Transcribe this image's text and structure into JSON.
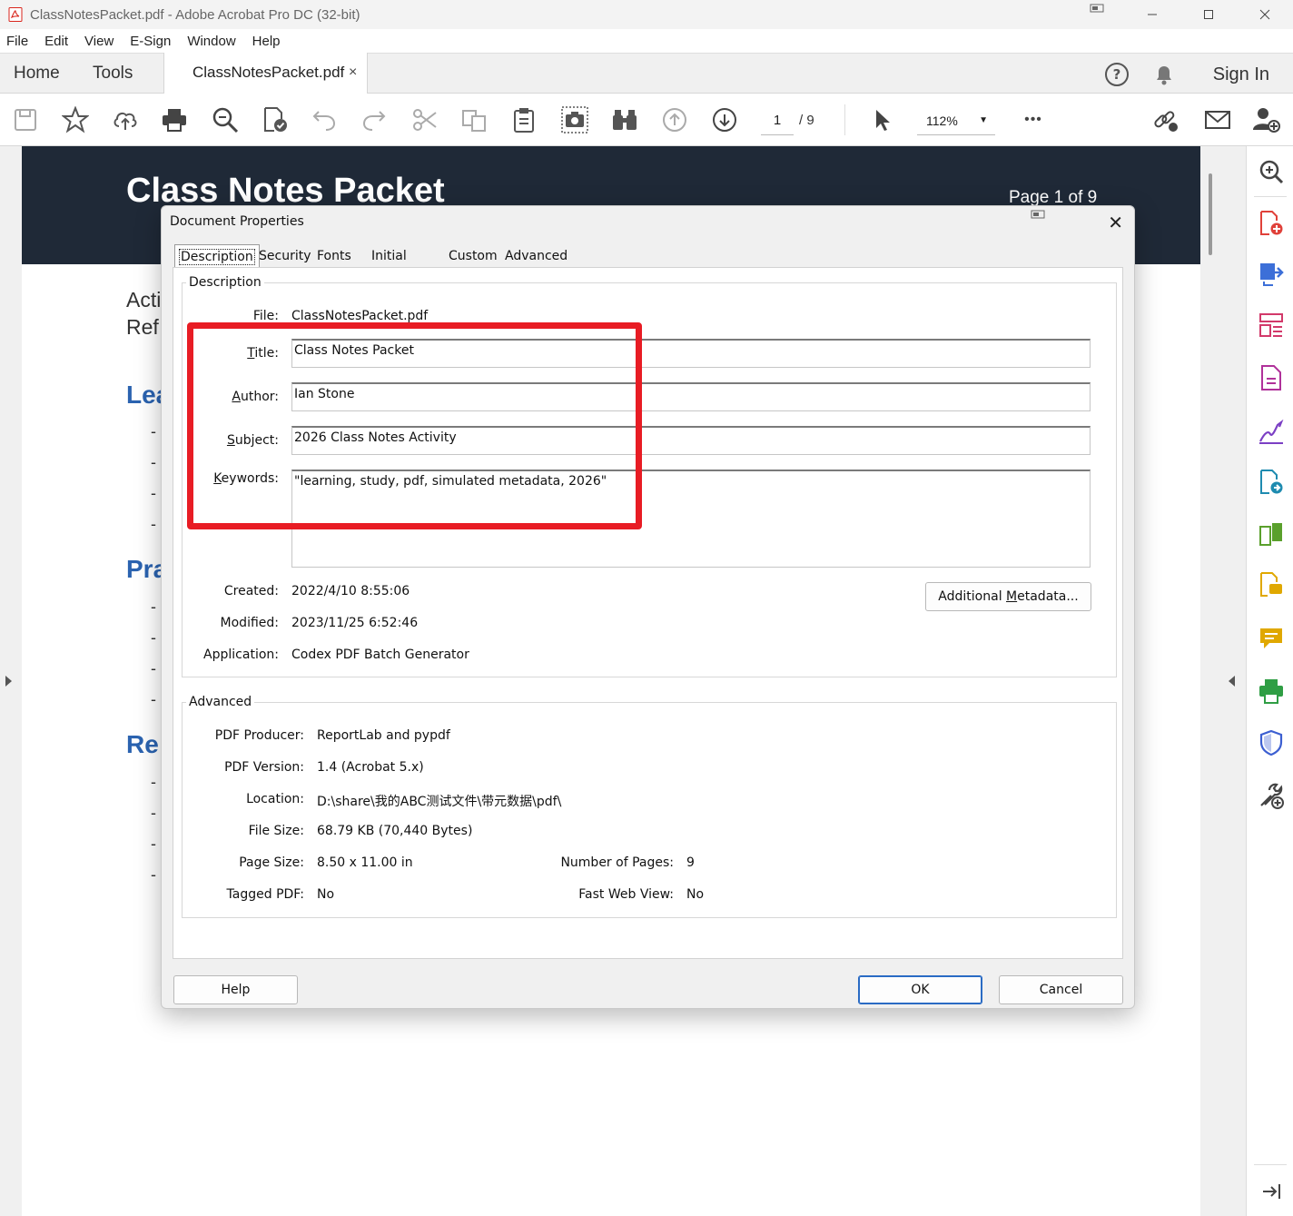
{
  "window": {
    "title": "ClassNotesPacket.pdf - Adobe Acrobat Pro DC (32-bit)"
  },
  "menu": [
    "File",
    "Edit",
    "View",
    "E-Sign",
    "Window",
    "Help"
  ],
  "tabs": {
    "home": "Home",
    "tools": "Tools",
    "document": "ClassNotesPacket.pdf",
    "close_glyph": "×",
    "sign_in": "Sign In"
  },
  "toolbar": {
    "page_current": "1",
    "page_total": "/ 9",
    "zoom": "112%",
    "more": "•••"
  },
  "page_content": {
    "title": "Class Notes Packet",
    "page_label": "Page 1 of 9",
    "partial_line1": "Acti",
    "partial_line2": "Ref",
    "heading1": "Lea",
    "heading2": "Pra",
    "heading3": "Re",
    "bullet": "-"
  },
  "dialog": {
    "title": "Document Properties",
    "close": "✕",
    "tabs": [
      "Description",
      "Security",
      "Fonts",
      "Initial View",
      "Custom",
      "Advanced"
    ],
    "active_tab": "Description",
    "description": {
      "group_title": "Description",
      "file_label": "File:",
      "file_value": "ClassNotesPacket.pdf",
      "title_label": "Title:",
      "title_value": "Class Notes Packet",
      "author_label": "Author:",
      "author_value": "Ian Stone",
      "subject_label": "Subject:",
      "subject_value": "2026 Class Notes Activity",
      "keywords_label": "Keywords:",
      "keywords_value": "\"learning, study, pdf, simulated metadata, 2026\"",
      "created_label": "Created:",
      "created_value": "2022/4/10 8:55:06",
      "modified_label": "Modified:",
      "modified_value": "2023/11/25 6:52:46",
      "application_label": "Application:",
      "application_value": "Codex PDF Batch Generator",
      "additional_metadata_button": "Additional Metadata..."
    },
    "advanced": {
      "group_title": "Advanced",
      "producer_label": "PDF Producer:",
      "producer_value": "ReportLab and pypdf",
      "version_label": "PDF Version:",
      "version_value": "1.4 (Acrobat 5.x)",
      "location_label": "Location:",
      "location_value": "D:\\share\\我的ABC测试文件\\带元数据\\pdf\\",
      "filesize_label": "File Size:",
      "filesize_value": "68.79 KB (70,440 Bytes)",
      "pagesize_label": "Page Size:",
      "pagesize_value": "8.50 x 11.00 in",
      "numpages_label": "Number of Pages:",
      "numpages_value": "9",
      "tagged_label": "Tagged PDF:",
      "tagged_value": "No",
      "fastweb_label": "Fast Web View:",
      "fastweb_value": "No"
    },
    "buttons": {
      "help": "Help",
      "ok": "OK",
      "cancel": "Cancel"
    }
  },
  "colors": {
    "highlight_box": "#e81c24",
    "page_banner": "#1f2937",
    "heading_blue": "#2b63b0",
    "ok_border": "#2a6bc4"
  }
}
